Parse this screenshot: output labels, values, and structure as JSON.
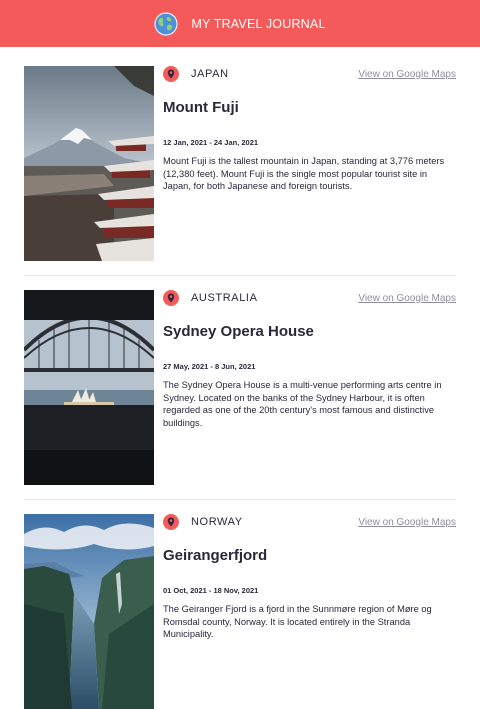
{
  "header": {
    "title": "MY TRAVEL JOURNAL",
    "icon": "globe-icon"
  },
  "entries": [
    {
      "country": "JAPAN",
      "maps_link": "View on Google Maps",
      "title": "Mount Fuji",
      "dates": "12 Jan, 2021 - 24 Jan, 2021",
      "description": "Mount Fuji is the tallest mountain in Japan, standing at 3,776 meters (12,380 feet). Mount Fuji is the single most popular tourist site in Japan, for both Japanese and foreign tourists."
    },
    {
      "country": "AUSTRALIA",
      "maps_link": "View on Google Maps",
      "title": "Sydney Opera House",
      "dates": "27 May, 2021 - 8 Jun, 2021",
      "description": "The Sydney Opera House is a multi-venue performing arts centre in Sydney. Located on the banks of the Sydney Harbour, it is often regarded as one of the 20th century's most famous and distinctive buildings."
    },
    {
      "country": "NORWAY",
      "maps_link": "View on Google Maps",
      "title": "Geirangerfjord",
      "dates": "01 Oct, 2021 - 18 Nov, 2021",
      "description": "The Geiranger Fjord is a fjord in the Sunnmøre region of Møre og Romsdal county, Norway. It is located entirely in the Stranda Municipality."
    }
  ],
  "colors": {
    "accent": "#f55a5a",
    "text": "#2b283a",
    "muted": "#918e9b"
  }
}
